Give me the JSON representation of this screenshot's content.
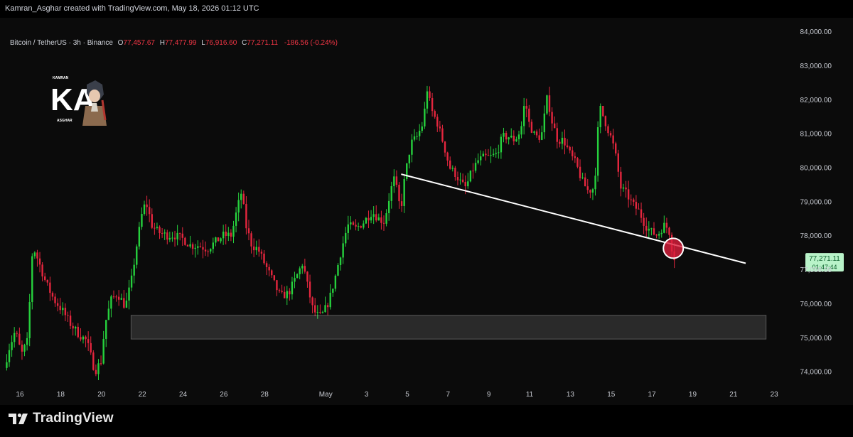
{
  "header": {
    "caption": "Kamran_Asghar created with TradingView.com, May 18, 2026 01:12 UTC"
  },
  "legend": {
    "symbol": "Bitcoin / TetherUS · 3h · Binance",
    "o_label": "O",
    "o_value": "77,457.67",
    "h_label": "H",
    "h_value": "77,477.99",
    "l_label": "L",
    "l_value": "76,916.60",
    "c_label": "C",
    "c_value": "77,271.11",
    "change": "-186.56 (-0.24%)"
  },
  "price_tag": {
    "price": "77,271.11",
    "countdown": "01:47:44"
  },
  "logo": {
    "letters": "KA",
    "top_text": "KAMRAN",
    "bottom_text": "ASGHAR"
  },
  "brand": {
    "name": "TradingView"
  },
  "colors": {
    "up": "#26d13d",
    "down": "#e5263e",
    "background": "#0b0b0b",
    "trendline": "#ffffff",
    "tag_bg": "#b9f3c9"
  },
  "chart_data": {
    "type": "candlestick",
    "title": "",
    "symbol": "BTCUSDT",
    "interval": "3h",
    "exchange": "Binance",
    "y_axis": {
      "labels": [
        "84,000.00",
        "83,000.00",
        "82,000.00",
        "81,000.00",
        "80,000.00",
        "79,000.00",
        "78,000.00",
        "77,000.00",
        "76,000.00",
        "75,000.00",
        "74,000.00"
      ],
      "ylim": [
        73700,
        84400
      ]
    },
    "x_axis": {
      "labels": [
        "16",
        "18",
        "20",
        "22",
        "24",
        "26",
        "28",
        "May",
        "3",
        "5",
        "7",
        "9",
        "11",
        "13",
        "15",
        "17",
        "19",
        "21",
        "23"
      ]
    },
    "x_range": [
      15.3,
      23.9
    ],
    "price_path": [
      [
        15.35,
        74100
      ],
      [
        15.6,
        74700
      ],
      [
        15.9,
        75200
      ],
      [
        16.2,
        74500
      ],
      [
        16.5,
        74900
      ],
      [
        16.75,
        77700
      ],
      [
        17.0,
        77300
      ],
      [
        17.4,
        76600
      ],
      [
        17.8,
        76100
      ],
      [
        18.2,
        75800
      ],
      [
        18.6,
        75400
      ],
      [
        19.0,
        75100
      ],
      [
        19.4,
        74900
      ],
      [
        19.8,
        74000
      ],
      [
        20.1,
        74300
      ],
      [
        20.3,
        75400
      ],
      [
        20.6,
        76100
      ],
      [
        20.9,
        76300
      ],
      [
        21.3,
        75900
      ],
      [
        21.6,
        76700
      ],
      [
        21.85,
        77700
      ],
      [
        22.1,
        78600
      ],
      [
        22.3,
        79000
      ],
      [
        22.6,
        78300
      ],
      [
        22.9,
        78100
      ],
      [
        23.3,
        78000
      ],
      [
        23.7,
        78000
      ],
      [
        24.1,
        77900
      ],
      [
        24.5,
        77700
      ],
      [
        24.9,
        77700
      ],
      [
        25.3,
        77600
      ],
      [
        25.7,
        77800
      ],
      [
        26.1,
        78000
      ],
      [
        26.5,
        78000
      ],
      [
        26.75,
        78700
      ],
      [
        27.0,
        79300
      ],
      [
        27.2,
        78300
      ],
      [
        27.5,
        77700
      ],
      [
        27.8,
        77600
      ],
      [
        28.1,
        77200
      ],
      [
        28.5,
        76700
      ],
      [
        28.9,
        76200
      ],
      [
        29.3,
        76300
      ],
      [
        29.7,
        76800
      ],
      [
        30.0,
        77200
      ],
      [
        30.2,
        76600
      ],
      [
        30.5,
        75800
      ],
      [
        30.8,
        75600
      ],
      [
        31.0,
        75700
      ],
      [
        31.3,
        76100
      ],
      [
        31.6,
        76800
      ],
      [
        31.9,
        77600
      ],
      [
        32.2,
        78300
      ],
      [
        32.6,
        78200
      ],
      [
        33.0,
        78400
      ],
      [
        33.4,
        78700
      ],
      [
        33.7,
        78500
      ],
      [
        34.0,
        78400
      ],
      [
        34.3,
        79300
      ],
      [
        34.5,
        79700
      ],
      [
        34.8,
        78700
      ],
      [
        35.0,
        79700
      ],
      [
        35.3,
        80700
      ],
      [
        35.6,
        80900
      ],
      [
        35.9,
        81300
      ],
      [
        36.1,
        82300
      ],
      [
        36.3,
        81700
      ],
      [
        36.6,
        81300
      ],
      [
        36.9,
        80700
      ],
      [
        37.2,
        80000
      ],
      [
        37.5,
        79800
      ],
      [
        37.8,
        79500
      ],
      [
        38.0,
        79400
      ],
      [
        38.3,
        79900
      ],
      [
        38.6,
        80200
      ],
      [
        38.9,
        80300
      ],
      [
        39.2,
        80300
      ],
      [
        39.5,
        80400
      ],
      [
        39.8,
        80900
      ],
      [
        40.1,
        80900
      ],
      [
        40.4,
        80800
      ],
      [
        40.7,
        81100
      ],
      [
        40.9,
        82000
      ],
      [
        41.1,
        81300
      ],
      [
        41.4,
        80900
      ],
      [
        41.7,
        80900
      ],
      [
        42.0,
        82100
      ],
      [
        42.2,
        81400
      ],
      [
        42.5,
        80800
      ],
      [
        42.8,
        80800
      ],
      [
        43.1,
        80400
      ],
      [
        43.4,
        80100
      ],
      [
        43.7,
        79600
      ],
      [
        44.0,
        79300
      ],
      [
        44.3,
        79400
      ],
      [
        44.55,
        81800
      ],
      [
        44.8,
        81400
      ],
      [
        45.1,
        80900
      ],
      [
        45.3,
        80500
      ],
      [
        45.6,
        79400
      ],
      [
        45.9,
        79200
      ],
      [
        46.2,
        78900
      ],
      [
        46.5,
        78700
      ],
      [
        46.8,
        78300
      ],
      [
        47.1,
        78100
      ],
      [
        47.4,
        78000
      ],
      [
        47.7,
        78300
      ],
      [
        47.95,
        78200
      ],
      [
        48.2,
        77280
      ]
    ],
    "trendline": {
      "from": [
        4.7,
        79800
      ],
      "to": [
        21.6,
        77180
      ]
    },
    "support_zone": {
      "x_from": 21.45,
      "x_to": 52.6,
      "y_low": 74950,
      "y_high": 75650
    },
    "highlight_circle": {
      "x": 48.05,
      "y": 77620
    },
    "last_price": 77271.11
  }
}
